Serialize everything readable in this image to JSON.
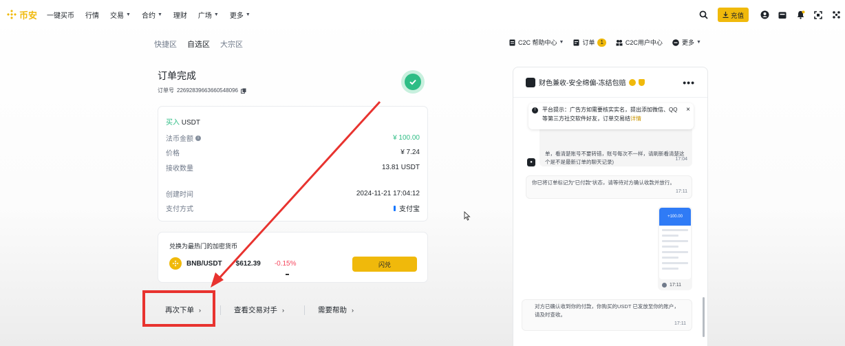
{
  "header": {
    "brand": "币安",
    "nav": [
      {
        "label": "一键买币",
        "dropdown": false
      },
      {
        "label": "行情",
        "dropdown": false
      },
      {
        "label": "交易",
        "dropdown": true
      },
      {
        "label": "合约",
        "dropdown": true
      },
      {
        "label": "理财",
        "dropdown": false
      },
      {
        "label": "广场",
        "dropdown": true
      },
      {
        "label": "更多",
        "dropdown": true
      }
    ],
    "deposit_label": "充值",
    "icons": [
      "search-icon",
      "download-icon",
      "user-icon",
      "wallet-icon",
      "bell-icon",
      "qr-icon",
      "globe-icon"
    ]
  },
  "subnav": {
    "tabs": [
      {
        "label": "快捷区",
        "active": false
      },
      {
        "label": "自选区",
        "active": true
      },
      {
        "label": "大宗区",
        "active": false
      }
    ],
    "links": {
      "help": "C2C 帮助中心",
      "orders": "订单",
      "orders_count": "1",
      "c2c_user": "C2C用户中心",
      "more": "更多"
    }
  },
  "order": {
    "title": "订单完成",
    "number_label": "订单号",
    "number": "22692839663660548096",
    "side": "买入",
    "asset": "USDT",
    "rows": {
      "fiat_amount": {
        "label": "法币金额",
        "value": "¥ 100.00"
      },
      "price": {
        "label": "价格",
        "value": "¥ 7.24"
      },
      "receive_qty": {
        "label": "接收数量",
        "value": "13.81 USDT"
      },
      "created_time": {
        "label": "创建时间",
        "value": "2024-11-21 17:04:12"
      },
      "payment_method": {
        "label": "支付方式",
        "value": "支付宝"
      }
    }
  },
  "convert": {
    "title": "兑换为最热门的加密货币",
    "pair": "BNB/USDT",
    "price": "$612.39",
    "change": "-0.15%",
    "button": "闪兑"
  },
  "actions": {
    "reorder": "再次下单",
    "view_counterparty": "查看交易对手",
    "need_help": "需要帮助"
  },
  "chat": {
    "shop_name": "财色兼收-安全绵偏-冻结包赔",
    "notice": {
      "text": "平台提示：广告方如需要核实实名，提出添加微信、QQ等第三方社交软件好友，订单交易结",
      "link": "详情"
    },
    "messages": [
      {
        "text": "单，看清楚账号不要转错，账号每次不一样，请刷新看清楚这个是不是最新订单的聊天记录)",
        "time": "17:04"
      },
      {
        "text": "你已将订单标记为\"已付款\"状态，请等待对方确认收款并放行。",
        "time": "17:11"
      },
      {
        "image_caption": "+100.00",
        "time": "17:11"
      },
      {
        "text": "对方已确认收到你的付款，你购买的USDT 已发放至你的账户，请及时查收。",
        "time": "17:11"
      }
    ]
  },
  "colors": {
    "brand": "#f0b90b",
    "buy": "#2ebd85",
    "sell": "#f6465d",
    "annotation": "#e8332f"
  }
}
